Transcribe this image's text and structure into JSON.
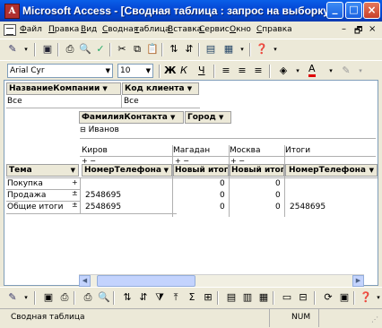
{
  "window": {
    "title": "Microsoft Access - [Сводная таблица : запрос на выборку]",
    "app_icon": "access-key-icon"
  },
  "menu": {
    "items": [
      "Файл",
      "Правка",
      "Вид",
      "Сводная",
      "таблица",
      "Вставка",
      "Сервис",
      "Окно",
      "Справка"
    ],
    "mdi_controls": [
      "–",
      "🗗",
      "×"
    ]
  },
  "toolbar_format": {
    "font": "Arial Cyr",
    "size": "10",
    "bold": "Ж",
    "italic": "К",
    "underline": "Ч",
    "font_color_letter": "A"
  },
  "pivot": {
    "filter_fields": [
      {
        "name": "НазваниеКомпании",
        "value": "Все"
      },
      {
        "name": "Код клиента",
        "value": "Все"
      }
    ],
    "column_fields": [
      "ФамилияКонтакта",
      "Город"
    ],
    "column_filter_value": "Иванов",
    "column_items": [
      "Киров",
      "Магадан",
      "Москва",
      "Итоги"
    ],
    "row_field": "Тема",
    "data_headers": [
      "НомерТелефона",
      "Новый итог",
      "Новый итог",
      "НомерТелефона"
    ],
    "rows": [
      {
        "label": "Покупка",
        "phone": "",
        "total1": "0",
        "total2": "0",
        "phone_total": ""
      },
      {
        "label": "Продажа",
        "phone": "2548695",
        "total1": "0",
        "total2": "0",
        "phone_total": ""
      },
      {
        "label": "Общие итоги",
        "phone": "2548695",
        "total1": "0",
        "total2": "0",
        "phone_total": "2548695"
      }
    ]
  },
  "status": {
    "text": "Сводная таблица",
    "num": "NUM"
  }
}
